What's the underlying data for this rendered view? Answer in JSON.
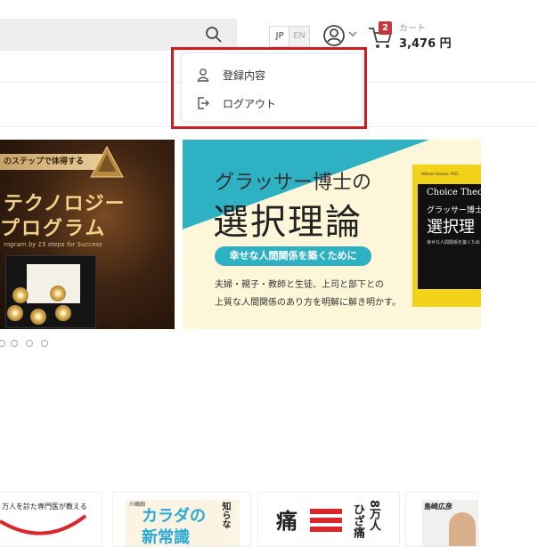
{
  "header": {
    "lang_jp": "JP",
    "lang_en": "EN",
    "cart_badge": "2",
    "cart_label": "カート",
    "cart_total": "3,476 円"
  },
  "user_menu": {
    "items": [
      {
        "label": "登録内容",
        "icon": "user-icon"
      },
      {
        "label": "ログアウト",
        "icon": "logout-icon"
      }
    ]
  },
  "banners": [
    {
      "tag": "のステップで体得する",
      "line1": "テクノロジー",
      "line2": "プログラム",
      "sub": "rogram by 15 steps for Success"
    },
    {
      "title_small": "グラッサー博士の",
      "title_large": "選択理論",
      "pill": "幸せな人間関係を築くために",
      "line1": "夫婦・親子・教師と生徒、上司と部下との",
      "line2": "上質な人間関係のあり方を明解に解き明かす。",
      "book_top": "William Glasser, M.D.",
      "book_en": "Choice Theo",
      "book_jp1": "グラッサー博士",
      "book_jp2": "選択理",
      "book_sub": "幸せな人間関係を築くため"
    }
  ],
  "carousel": {
    "dots": 4
  },
  "books": [
    {
      "line1": "万人を診た専門医が教える"
    },
    {
      "line1": "カラダの",
      "line2": "新常識",
      "line3": "知らな",
      "author": "川嶋朗"
    },
    {
      "line1": "痛",
      "line2": "8万人",
      "line3": "ひざ痛"
    },
    {
      "author": "島崎広彦"
    }
  ],
  "colors": {
    "accent_red": "#c4373f",
    "highlight": "#c81e1e",
    "teal": "#2fb1c4"
  }
}
